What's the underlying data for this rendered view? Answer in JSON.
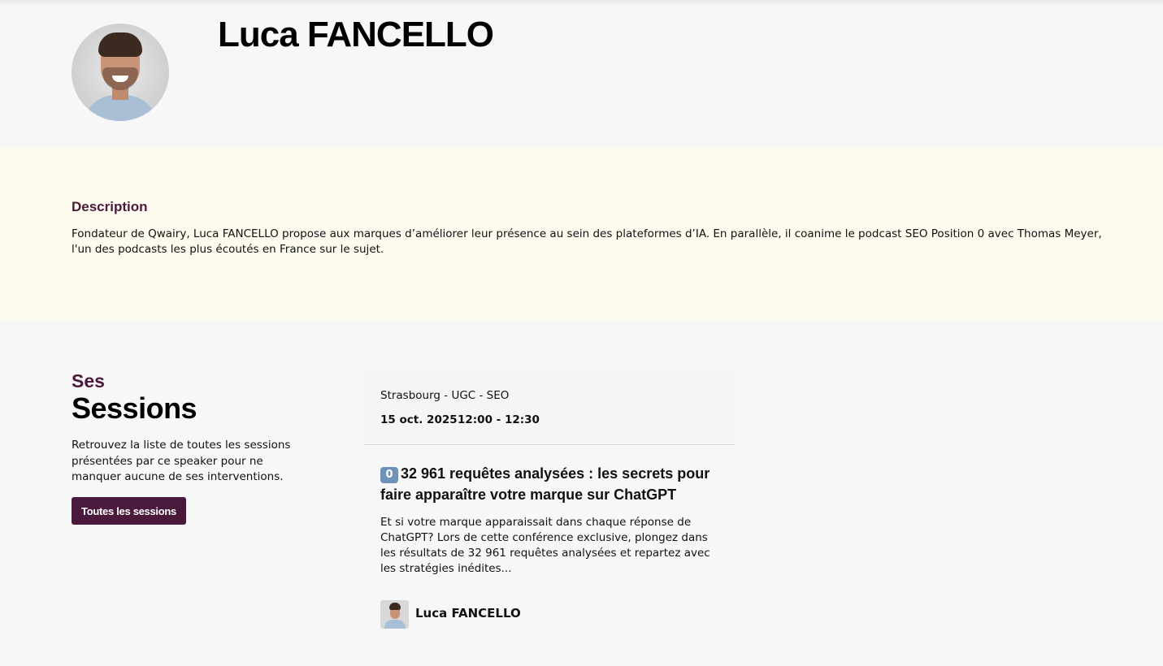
{
  "speaker": {
    "name": "Luca FANCELLO"
  },
  "description": {
    "title": "Description",
    "text": "Fondateur de Qwairy, Luca FANCELLO propose aux marques d’améliorer leur présence au sein des plateformes d’IA. En parallèle, il coanime le podcast SEO Position 0 avec Thomas Meyer, l'un des podcasts les plus écoutés en France sur le sujet."
  },
  "sessions": {
    "kicker": "Ses",
    "title": "Sessions",
    "text": "Retrouvez la liste de toutes les sessions présentées par ce speaker pour ne manquer aucune de ses interventions.",
    "button_label": "Toutes les sessions"
  },
  "session_card": {
    "location": "Strasbourg - UGC - SEO",
    "date": "15 oct. 2025",
    "time": "12:00 - 12:30",
    "title_icon": "0",
    "title": "32 961 requêtes analysées : les secrets pour faire apparaître votre marque sur ChatGPT",
    "description": "Et si votre marque apparaissait dans chaque réponse de ChatGPT? Lors de cette conférence exclusive, plongez dans les résultats de 32 961 requêtes analysées et repartez avec les stratégies inédites...",
    "speaker_name": "Luca FANCELLO"
  },
  "colors": {
    "accent": "#4a1a3d",
    "description_band": "#fdfaee",
    "page_background": "#f7f7f7"
  }
}
